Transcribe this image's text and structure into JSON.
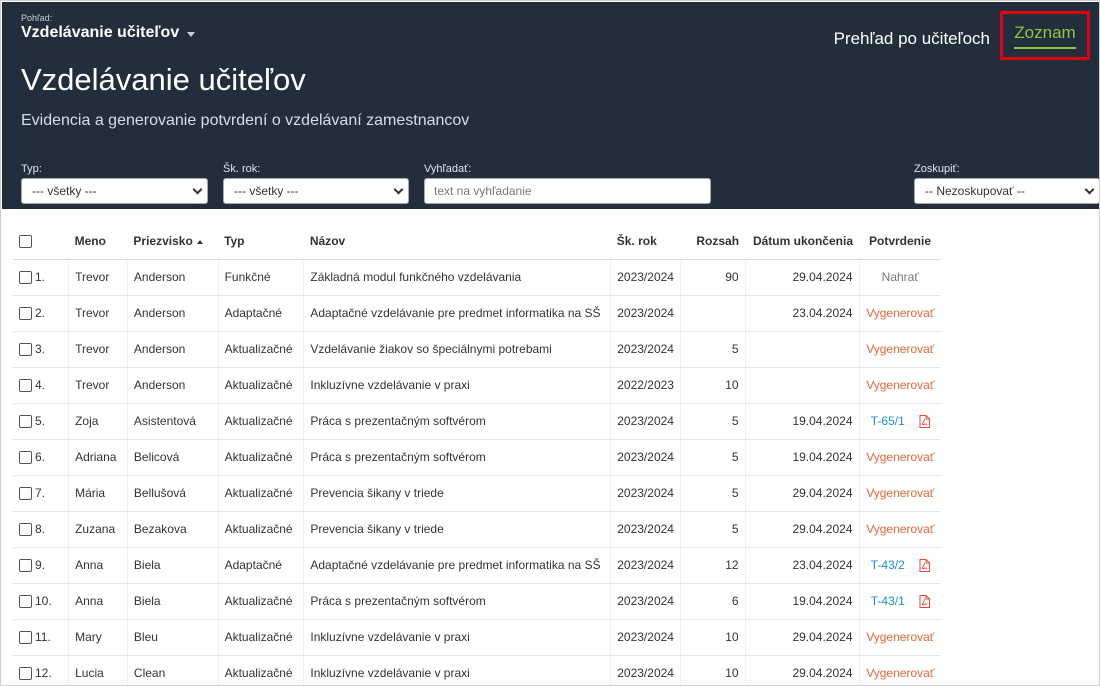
{
  "header": {
    "view_label": "Pohľad:",
    "view_value": "Vzdelávanie učiteľov",
    "nav": {
      "overview": "Prehľad po učiteľoch",
      "list": "Zoznam"
    },
    "title": "Vzdelávanie učiteľov",
    "subtitle": "Evidencia a generovanie potvrdení o vzdelávaní zamestnancov",
    "colors": {
      "background": "#232e3c",
      "accent": "#8ec63f",
      "highlight": "#e0000f"
    }
  },
  "filters": {
    "type": {
      "label": "Typ:",
      "value": "--- všetky ---"
    },
    "year": {
      "label": "Šk. rok:",
      "value": "--- všetky ---"
    },
    "search": {
      "label": "Vyhľadať:",
      "placeholder": "text na vyhľadanie"
    },
    "group": {
      "label": "Zoskupiť:",
      "value": "-- Nezoskupovať --"
    }
  },
  "table": {
    "columns": [
      "Meno",
      "Priezvisko",
      "Typ",
      "Názov",
      "Šk. rok",
      "Rozsah",
      "Dátum ukončenia",
      "Potvrdenie"
    ],
    "rows": [
      {
        "n": "1.",
        "meno": "Trevor",
        "priezvisko": "Anderson",
        "typ": "Funkčné",
        "nazov": "Základná modul funkčného vzdelávania",
        "rok": "2023/2024",
        "rozsah": "90",
        "datum": "29.04.2024",
        "potvrdenie": "Nahrať",
        "kind": "upload"
      },
      {
        "n": "2.",
        "meno": "Trevor",
        "priezvisko": "Anderson",
        "typ": "Adaptačné",
        "nazov": "Adaptačné vzdelávanie pre predmet informatika na SŠ",
        "rok": "2023/2024",
        "rozsah": "",
        "datum": "23.04.2024",
        "potvrdenie": "Vygenerovať",
        "kind": "generate"
      },
      {
        "n": "3.",
        "meno": "Trevor",
        "priezvisko": "Anderson",
        "typ": "Aktualizačné",
        "nazov": "Vzdelávanie žiakov so špeciálnymi potrebami",
        "rok": "2023/2024",
        "rozsah": "5",
        "datum": "",
        "potvrdenie": "Vygenerovať",
        "kind": "generate"
      },
      {
        "n": "4.",
        "meno": "Trevor",
        "priezvisko": "Anderson",
        "typ": "Aktualizačné",
        "nazov": "Inkluzívne vzdelávanie v praxi",
        "rok": "2022/2023",
        "rozsah": "10",
        "datum": "",
        "potvrdenie": "Vygenerovať",
        "kind": "generate"
      },
      {
        "n": "5.",
        "meno": "Zoja",
        "priezvisko": "Asistentová",
        "typ": "Aktualizačné",
        "nazov": "Práca s prezentačným softvérom",
        "rok": "2023/2024",
        "rozsah": "5",
        "datum": "19.04.2024",
        "potvrdenie": "T-65/1",
        "kind": "certificate"
      },
      {
        "n": "6.",
        "meno": "Adriana",
        "priezvisko": "Belicová",
        "typ": "Aktualizačné",
        "nazov": "Práca s prezentačným softvérom",
        "rok": "2023/2024",
        "rozsah": "5",
        "datum": "19.04.2024",
        "potvrdenie": "Vygenerovať",
        "kind": "generate"
      },
      {
        "n": "7.",
        "meno": "Mária",
        "priezvisko": "Bellušová",
        "typ": "Aktualizačné",
        "nazov": "Prevencia šikany v triede",
        "rok": "2023/2024",
        "rozsah": "5",
        "datum": "29.04.2024",
        "potvrdenie": "Vygenerovať",
        "kind": "generate"
      },
      {
        "n": "8.",
        "meno": "Zuzana",
        "priezvisko": "Bezakova",
        "typ": "Aktualizačné",
        "nazov": "Prevencia šikany v triede",
        "rok": "2023/2024",
        "rozsah": "5",
        "datum": "29.04.2024",
        "potvrdenie": "Vygenerovať",
        "kind": "generate"
      },
      {
        "n": "9.",
        "meno": "Anna",
        "priezvisko": "Biela",
        "typ": "Adaptačné",
        "nazov": "Adaptačné vzdelávanie pre predmet informatika na SŠ",
        "rok": "2023/2024",
        "rozsah": "12",
        "datum": "23.04.2024",
        "potvrdenie": "T-43/2",
        "kind": "certificate"
      },
      {
        "n": "10.",
        "meno": "Anna",
        "priezvisko": "Biela",
        "typ": "Aktualizačné",
        "nazov": "Práca s prezentačným softvérom",
        "rok": "2023/2024",
        "rozsah": "6",
        "datum": "19.04.2024",
        "potvrdenie": "T-43/1",
        "kind": "certificate"
      },
      {
        "n": "11.",
        "meno": "Mary",
        "priezvisko": "Bleu",
        "typ": "Aktualizačné",
        "nazov": "Inkluzívne vzdelávanie v praxi",
        "rok": "2023/2024",
        "rozsah": "10",
        "datum": "29.04.2024",
        "potvrdenie": "Vygenerovať",
        "kind": "generate"
      },
      {
        "n": "12.",
        "meno": "Lucia",
        "priezvisko": "Clean",
        "typ": "Aktualizačné",
        "nazov": "Inkluzívne vzdelávanie v praxi",
        "rok": "2023/2024",
        "rozsah": "10",
        "datum": "29.04.2024",
        "potvrdenie": "Vygenerovať",
        "kind": "generate"
      }
    ],
    "colors": {
      "generate": "#e8663a",
      "certificate": "#1a8fd0",
      "upload": "#777777",
      "pdf_icon": "#e8463a"
    }
  }
}
